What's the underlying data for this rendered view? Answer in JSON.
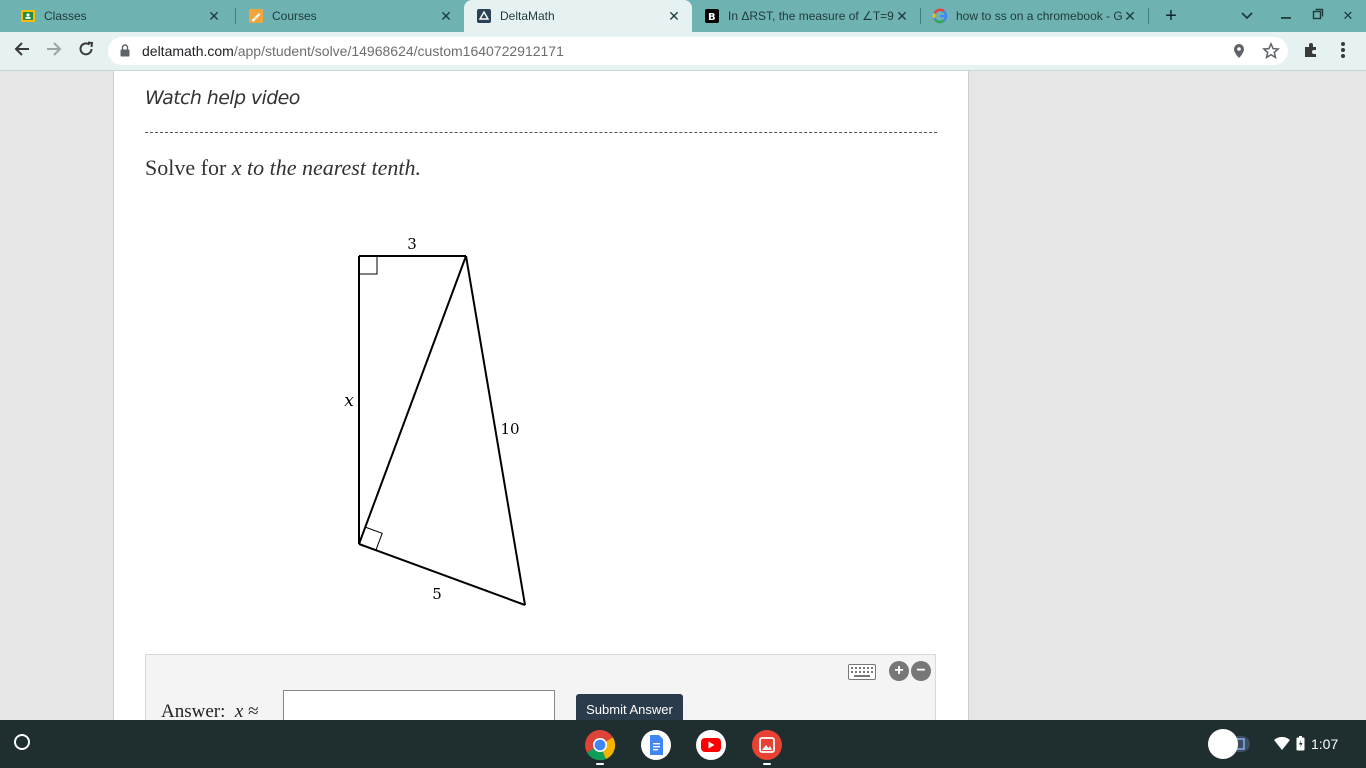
{
  "tabs": [
    {
      "title": "Classes",
      "icon": "google-classroom-icon",
      "active": false
    },
    {
      "title": "Courses",
      "icon": "courses-pencil-icon",
      "active": false
    },
    {
      "title": "DeltaMath",
      "icon": "deltamath-icon",
      "active": true
    },
    {
      "title": "In ΔRST, the measure of ∠T=9",
      "icon": "brainly-icon",
      "active": false
    },
    {
      "title": "how to ss on a chromebook - G",
      "icon": "google-icon",
      "active": false
    }
  ],
  "toolbar": {
    "url_host": "deltamath.com",
    "url_path": "/app/student/solve/14968624/custom1640722912171"
  },
  "page": {
    "help_link": "Watch help video",
    "prompt_prefix": "Solve for ",
    "prompt_var": "x",
    "prompt_suffix": " to the nearest tenth."
  },
  "figure": {
    "label_top": "3",
    "label_left": "x",
    "label_right": "10",
    "label_bottom": "5"
  },
  "answer": {
    "label": "Answer:",
    "var": "x",
    "approx_symbol": "≈",
    "value": "",
    "submit_label": "Submit Answer",
    "zoom_in": "+",
    "zoom_out": "−"
  },
  "shelf": {
    "apps": [
      "chrome-icon",
      "google-docs-icon",
      "youtube-icon",
      "gallery-icon"
    ],
    "time": "1:07"
  },
  "colors": {
    "tabstrip": "#6fb2b2",
    "toolbar": "#e6f2f2",
    "submit": "#2a3b4c",
    "shelf": "#1f2e2e"
  }
}
